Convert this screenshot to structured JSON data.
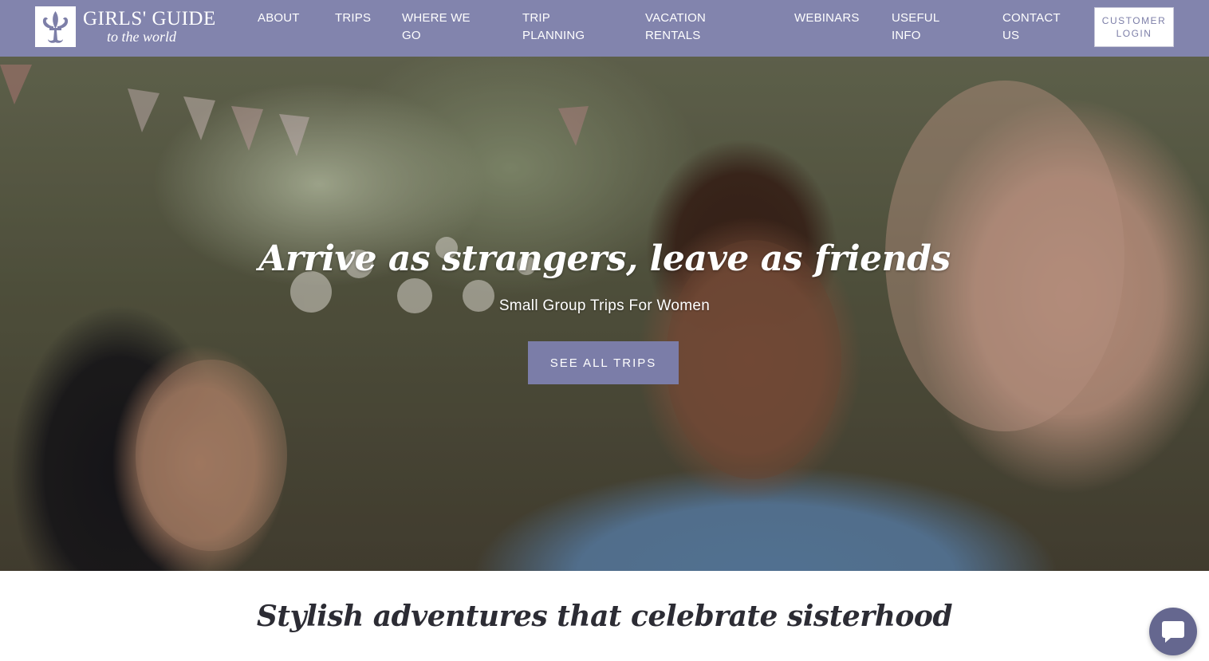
{
  "brand": {
    "title": "GIRLS' GUIDE",
    "subtitle": "to the world",
    "logo_icon": "fleur-de-lis-icon"
  },
  "nav": {
    "about": "ABOUT",
    "trips": "TRIPS",
    "where_we_go": "WHERE WE GO",
    "trip_planning": "TRIP PLANNING",
    "vacation_rentals": "VACATION RENTALS",
    "webinars": "WEBINARS",
    "useful_info": "USEFUL INFO",
    "contact_us": "CONTACT US",
    "customer_login": "CUSTOMER LOGIN"
  },
  "hero": {
    "heading": "Arrive as strangers, leave as friends",
    "subheading": "Small Group Trips For Women",
    "cta_label": "SEE ALL TRIPS"
  },
  "section": {
    "title": "Stylish adventures that celebrate sisterhood"
  },
  "chat": {
    "icon": "chat-bubble-icon"
  },
  "colors": {
    "header_bg": "#8284ad",
    "cta_bg": "#7b7da8",
    "chat_bg": "#65678f",
    "text_dark": "#2c2c34"
  }
}
